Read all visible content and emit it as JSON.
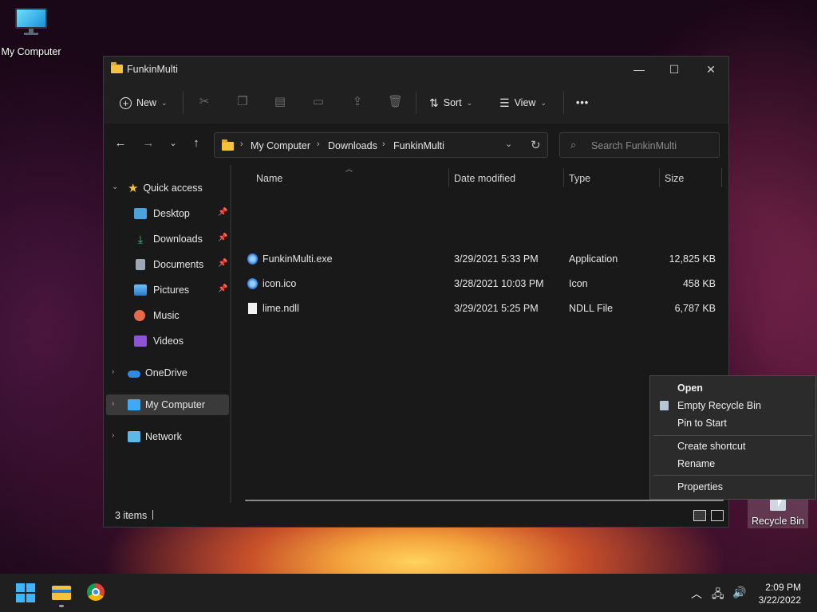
{
  "desktop": {
    "my_computer_label": "My Computer",
    "recycle_bin_label": "Recycle Bin"
  },
  "window": {
    "title": "FunkinMulti",
    "controls": {
      "minimize": "—",
      "maximize": "☐",
      "close": "✕"
    }
  },
  "toolbar": {
    "new_label": "New",
    "sort_label": "Sort",
    "view_label": "View",
    "more_label": "•••"
  },
  "address": {
    "crumbs": [
      "My Computer",
      "Downloads",
      "FunkinMulti"
    ],
    "search_placeholder": "Search FunkinMulti"
  },
  "sidebar": {
    "quick_access": "Quick access",
    "items": [
      {
        "label": "Desktop",
        "pinned": true,
        "icon": "desktop-icon",
        "color": "#4aa3df"
      },
      {
        "label": "Downloads",
        "pinned": true,
        "icon": "download-icon",
        "color": "#3ec47a"
      },
      {
        "label": "Documents",
        "pinned": true,
        "icon": "document-icon",
        "color": "#9aa7b5"
      },
      {
        "label": "Pictures",
        "pinned": true,
        "icon": "pictures-icon",
        "color": "#3d9be9"
      },
      {
        "label": "Music",
        "pinned": false,
        "icon": "music-icon",
        "color": "#e66a4a"
      },
      {
        "label": "Videos",
        "pinned": false,
        "icon": "videos-icon",
        "color": "#8b55d6"
      }
    ],
    "onedrive": "OneDrive",
    "my_computer": "My Computer",
    "network": "Network"
  },
  "columns": {
    "name": "Name",
    "date": "Date modified",
    "type": "Type",
    "size": "Size"
  },
  "files": [
    {
      "name": "FunkinMulti.exe",
      "date": "3/29/2021 5:33 PM",
      "type": "Application",
      "size": "12,825 KB"
    },
    {
      "name": "icon.ico",
      "date": "3/28/2021 10:03 PM",
      "type": "Icon",
      "size": "458 KB"
    },
    {
      "name": "lime.ndll",
      "date": "3/29/2021 5:25 PM",
      "type": "NDLL File",
      "size": "6,787 KB"
    }
  ],
  "status": {
    "items_count": "3 items"
  },
  "context_menu": {
    "open": "Open",
    "empty": "Empty Recycle Bin",
    "pin": "Pin to Start",
    "shortcut": "Create shortcut",
    "rename": "Rename",
    "properties": "Properties"
  },
  "taskbar": {
    "time": "2:09 PM",
    "date": "3/22/2022"
  }
}
